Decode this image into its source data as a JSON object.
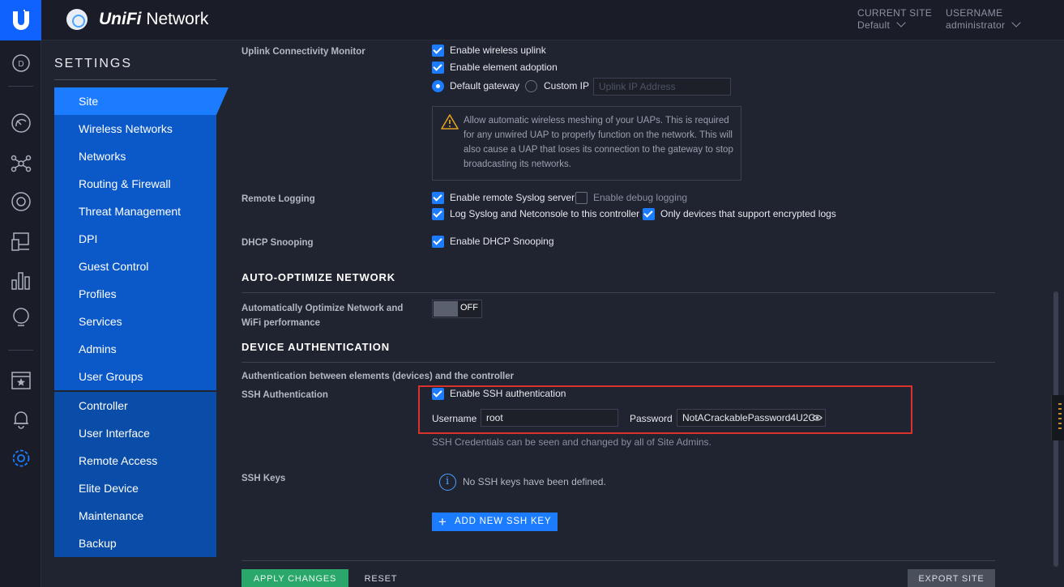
{
  "header": {
    "brand_prefix": "UniFi",
    "brand_suffix": " Network",
    "current_site_label": "CURRENT SITE",
    "current_site_value": "Default",
    "username_label": "USERNAME",
    "username_value": "administrator"
  },
  "rail": {
    "items": [
      "dashboard-icon",
      "statistics-icon",
      "topology-icon",
      "devices-icon",
      "clients-icon",
      "insights-icon",
      "ideas-icon",
      "events-icon",
      "alerts-icon",
      "settings-icon"
    ],
    "dashboard_letter": "D"
  },
  "settings": {
    "title": "SETTINGS",
    "menu": [
      "Site",
      "Wireless Networks",
      "Networks",
      "Routing & Firewall",
      "Threat Management",
      "DPI",
      "Guest Control",
      "Profiles",
      "Services",
      "Admins",
      "User Groups"
    ],
    "menu2": [
      "Controller",
      "User Interface",
      "Remote Access",
      "Elite Device",
      "Maintenance",
      "Backup"
    ],
    "active": "Site"
  },
  "uplink": {
    "label": "Uplink Connectivity Monitor",
    "wireless_uplink": "Enable wireless uplink",
    "element_adoption": "Enable element adoption",
    "default_gateway": "Default gateway",
    "custom_ip": "Custom IP",
    "uplink_ip_placeholder": "Uplink IP Address",
    "warning": "Allow automatic wireless meshing of your UAPs. This is required for any unwired UAP to properly function on the network. This will also cause a UAP that loses its connection to the gateway to stop broadcasting its networks."
  },
  "remote_logging": {
    "label": "Remote Logging",
    "syslog": "Enable remote Syslog server",
    "debug": "Enable debug logging",
    "netconsole": "Log Syslog and Netconsole to this controller",
    "encrypted": "Only devices that support encrypted logs"
  },
  "dhcp": {
    "label": "DHCP Snooping",
    "enable": "Enable DHCP Snooping"
  },
  "auto_optimize": {
    "heading": "AUTO-OPTIMIZE NETWORK",
    "label": "Automatically Optimize Network and WiFi performance",
    "toggle": "OFF"
  },
  "device_auth": {
    "heading": "DEVICE AUTHENTICATION",
    "subtitle": "Authentication between elements (devices) and the controller",
    "ssh_label": "SSH Authentication",
    "ssh_enable": "Enable SSH authentication",
    "username_label": "Username",
    "username_value": "root",
    "password_label": "Password",
    "password_value": "NotACrackablePassword4U2C",
    "note": "SSH Credentials can be seen and changed by all of Site Admins.",
    "keys_label": "SSH Keys",
    "no_keys": "No SSH keys have been defined.",
    "add_key": "ADD NEW SSH KEY"
  },
  "footer": {
    "apply": "APPLY CHANGES",
    "reset": "RESET",
    "export": "EXPORT SITE"
  },
  "colors": {
    "accent": "#1b7cff",
    "menu_bg": "#0b59c8",
    "highlight": "#d8322a"
  }
}
